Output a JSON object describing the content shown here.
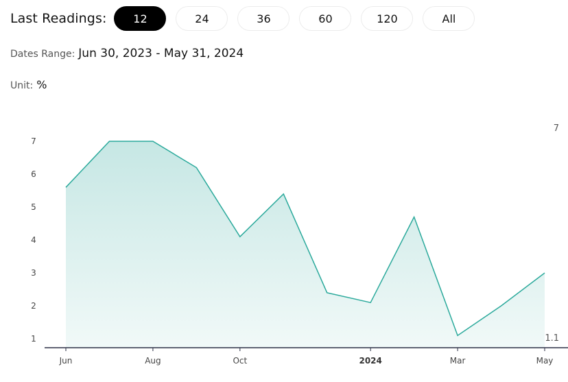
{
  "toolbar": {
    "label": "Last Readings:",
    "options": [
      {
        "label": "12",
        "active": true
      },
      {
        "label": "24",
        "active": false
      },
      {
        "label": "36",
        "active": false
      },
      {
        "label": "60",
        "active": false
      },
      {
        "label": "120",
        "active": false
      },
      {
        "label": "All",
        "active": false
      }
    ]
  },
  "dates_range": {
    "label": "Dates Range:",
    "value": "Jun 30, 2023 - May 31, 2024"
  },
  "unit": {
    "label": "Unit:",
    "value": "%"
  },
  "colors": {
    "line": "#2aa99b",
    "fill_top": "#c6e7e4",
    "fill_bottom": "#f1f9f8",
    "axis": "#2b2f45",
    "active_pill": "#000000"
  },
  "chart_data": {
    "type": "area",
    "title": "",
    "xlabel": "",
    "ylabel": "",
    "x": [
      "Jun 2023",
      "Jul 2023",
      "Aug 2023",
      "Sep 2023",
      "Oct 2023",
      "Nov 2023",
      "Dec 2023",
      "Jan 2024",
      "Feb 2024",
      "Mar 2024",
      "Apr 2024",
      "May 2024"
    ],
    "series": [
      {
        "name": "%",
        "values": [
          5.6,
          7.0,
          7.0,
          6.2,
          4.1,
          5.4,
          2.4,
          2.1,
          4.7,
          1.1,
          2.0,
          3.0
        ]
      }
    ],
    "x_ticks": [
      {
        "index": 0,
        "label": "Jun",
        "bold": false
      },
      {
        "index": 2,
        "label": "Aug",
        "bold": false
      },
      {
        "index": 4,
        "label": "Oct",
        "bold": false
      },
      {
        "index": 7,
        "label": "2024",
        "bold": true
      },
      {
        "index": 9,
        "label": "Mar",
        "bold": false
      },
      {
        "index": 11,
        "label": "May",
        "bold": false
      }
    ],
    "y_ticks": [
      1,
      2,
      3,
      4,
      5,
      6,
      7
    ],
    "ylim": [
      0.8,
      7.0
    ],
    "range_labels": {
      "max": "7",
      "min": "1.1"
    },
    "grid": false,
    "legend": "none"
  }
}
